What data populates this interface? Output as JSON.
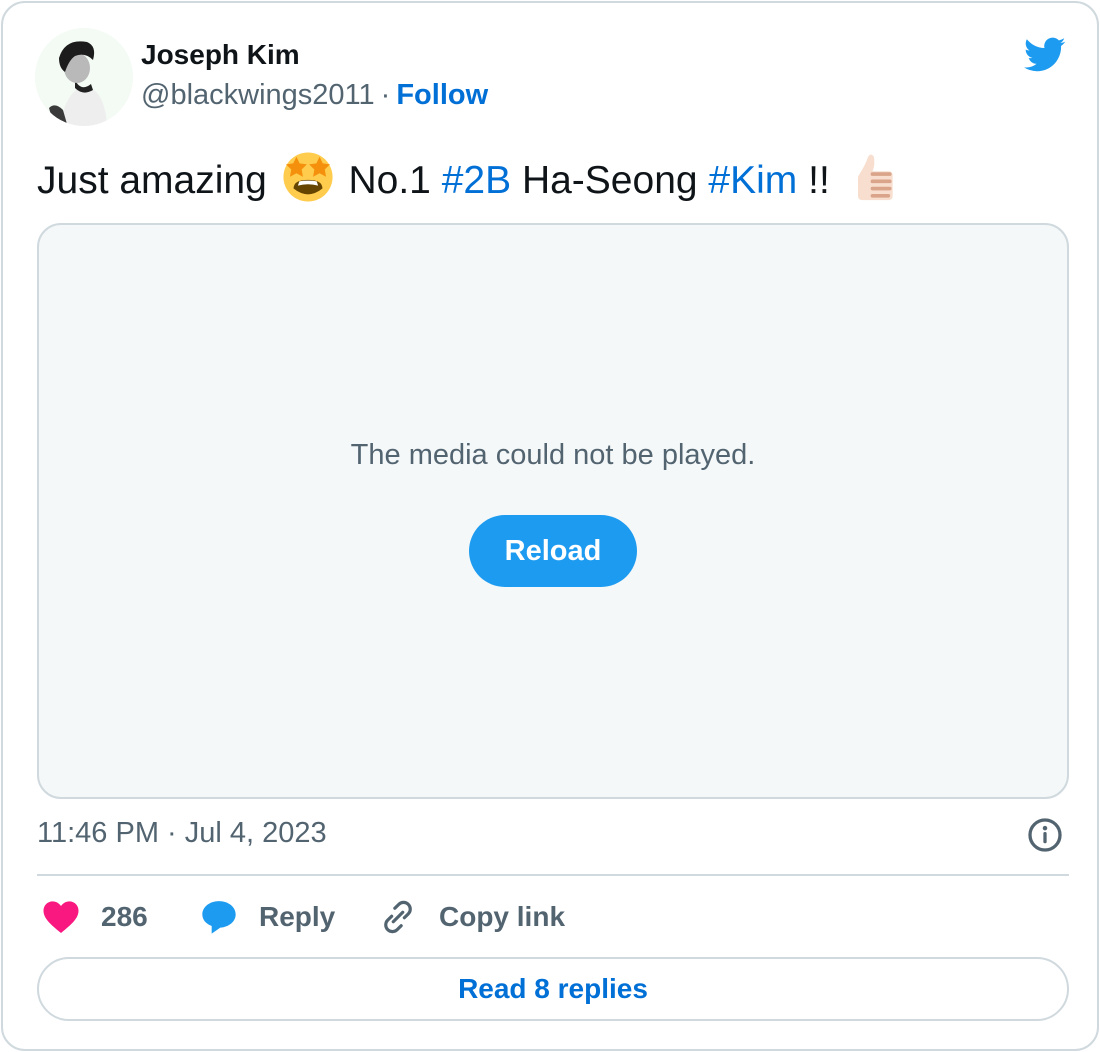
{
  "author": {
    "name": "Joseph Kim",
    "handle": "@blackwings2011",
    "separator": "·",
    "follow_label": "Follow",
    "avatar_icon": "profile-photo"
  },
  "brand": {
    "logo_icon": "twitter-bird-icon",
    "accent_color": "#1d9bf0",
    "link_color": "#006fd6"
  },
  "tweet": {
    "segments": [
      {
        "type": "text",
        "value": "Just amazing "
      },
      {
        "type": "emoji",
        "icon": "star-struck-emoji"
      },
      {
        "type": "text",
        "value": " No.1 "
      },
      {
        "type": "hashtag",
        "value": "#2B"
      },
      {
        "type": "text",
        "value": " Ha-Seong "
      },
      {
        "type": "hashtag",
        "value": "#Kim"
      },
      {
        "type": "text",
        "value": " !! "
      },
      {
        "type": "emoji",
        "icon": "thumbs-up-light-skin-emoji"
      }
    ],
    "text_parts": {
      "p1": "Just amazing",
      "p2": "No.1",
      "hashtag1": "#2B",
      "p3": "Ha-Seong",
      "hashtag2": "#Kim",
      "p4": "!!"
    }
  },
  "media": {
    "error_message": "The media could not be played.",
    "reload_label": "Reload"
  },
  "timestamp": "11:46 PM · Jul 4, 2023",
  "actions": {
    "like_count": "286",
    "like_color": "#f91880",
    "reply_label": "Reply",
    "copy_link_label": "Copy link"
  },
  "read_replies_label": "Read 8 replies"
}
